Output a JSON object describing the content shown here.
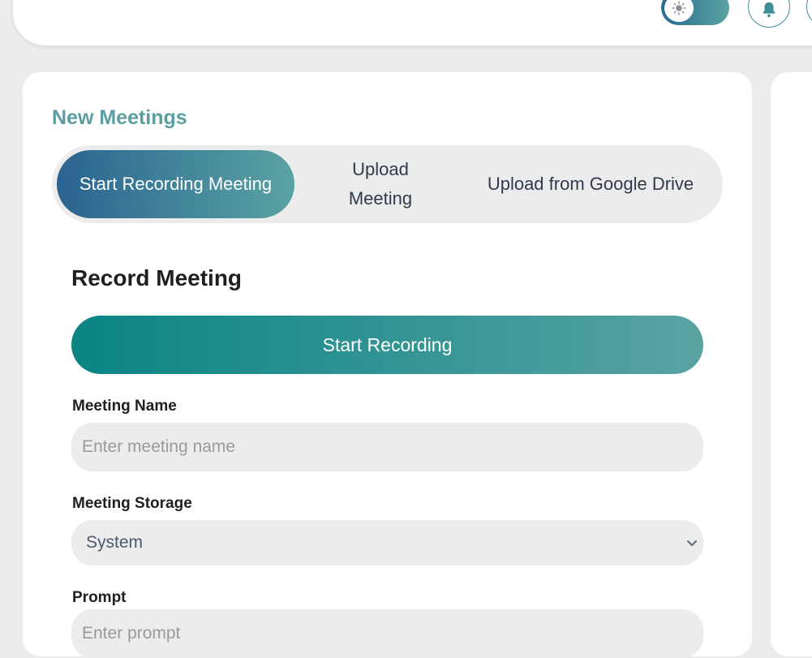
{
  "header": {
    "theme_toggle_icon": "sun-icon",
    "notification_icon": "bell-icon"
  },
  "new_meetings": {
    "title": "New Meetings",
    "tabs": [
      {
        "label": "Start Recording Meeting",
        "active": true
      },
      {
        "label": "Upload Meeting",
        "active": false
      },
      {
        "label": "Upload from Google Drive",
        "active": false
      }
    ]
  },
  "record": {
    "title": "Record Meeting",
    "start_button": "Start Recording",
    "meeting_name": {
      "label": "Meeting Name",
      "placeholder": "Enter meeting name",
      "value": ""
    },
    "meeting_storage": {
      "label": "Meeting Storage",
      "selected": "System"
    },
    "prompt": {
      "label": "Prompt",
      "placeholder": "Enter prompt",
      "value": ""
    }
  },
  "colors": {
    "accent_teal": "#5aa3a3",
    "accent_blue": "#2a6390",
    "button_teal": "#0a8484",
    "background": "#ececec"
  }
}
